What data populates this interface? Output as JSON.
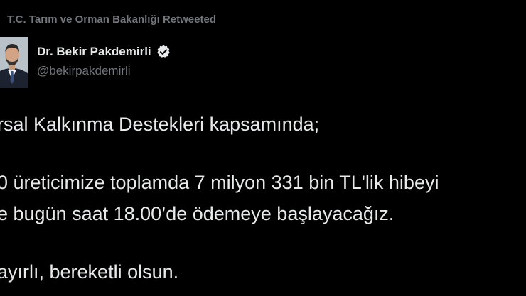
{
  "retweet": {
    "text": "T.C. Tarım ve Orman Bakanlığı Retweeted",
    "icon": "retweet-icon"
  },
  "author": {
    "name": "Dr. Bekir Pakdemirli",
    "handle": "@bekirpakdemirli",
    "verified_icon": "verified-badge-icon",
    "verified_color": "#e7e9ea"
  },
  "tweet": {
    "lines": [
      "rsal Kalkınma Destekleri kapsamında;",
      "0 üreticimize toplamda 7 milyon 331 bin TL'lik hibeyi",
      "e bugün saat 18.00’de ödemeye başlayacağız.",
      "ayırlı, bereketli olsun."
    ]
  },
  "colors": {
    "background": "#000000",
    "text": "#e7e9ea",
    "secondary": "#71767b"
  }
}
